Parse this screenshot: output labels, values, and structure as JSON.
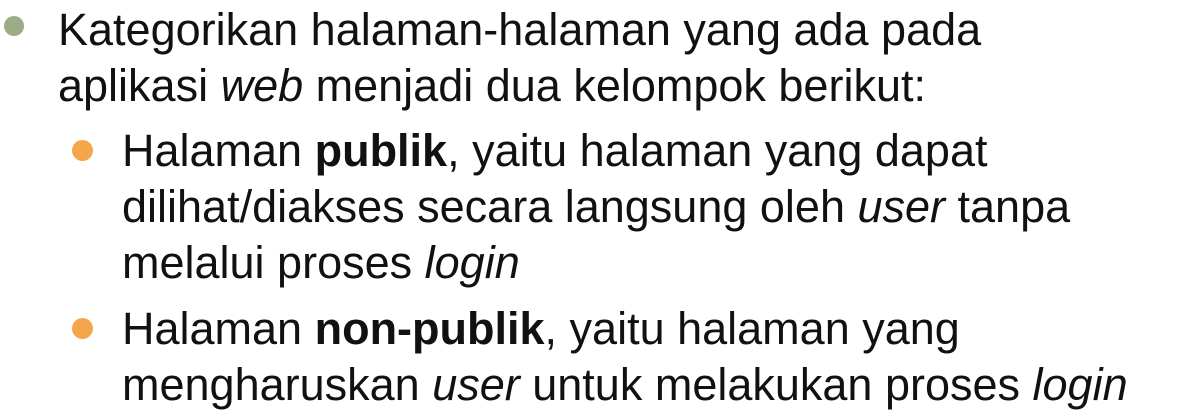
{
  "colors": {
    "bullet_level_1": "#9aad87",
    "bullet_level_2": "#f5a54a",
    "text": "#111111"
  },
  "bullet_main": {
    "line_1": "Kategorikan halaman-halaman yang ada pada",
    "line_2_pre": "aplikasi ",
    "line_2_em": "web",
    "line_2_post": " menjadi dua kelompok berikut:"
  },
  "sub_bullets": [
    {
      "line_1_pre": "Halaman ",
      "line_1_bold": "publik",
      "line_1_post": ", yaitu halaman yang dapat",
      "line_2_pre": "dilihat/diakses secara langsung oleh ",
      "line_2_em": "user",
      "line_2_post": " tanpa",
      "line_3_pre": "melalui proses ",
      "line_3_em": "login"
    },
    {
      "line_1_pre": "Halaman ",
      "line_1_bold": "non-publik",
      "line_1_post": ", yaitu halaman yang",
      "line_2_pre": "mengharuskan ",
      "line_2_em": "user",
      "line_2_mid": " untuk melakukan proses ",
      "line_2_em2": "login"
    }
  ]
}
